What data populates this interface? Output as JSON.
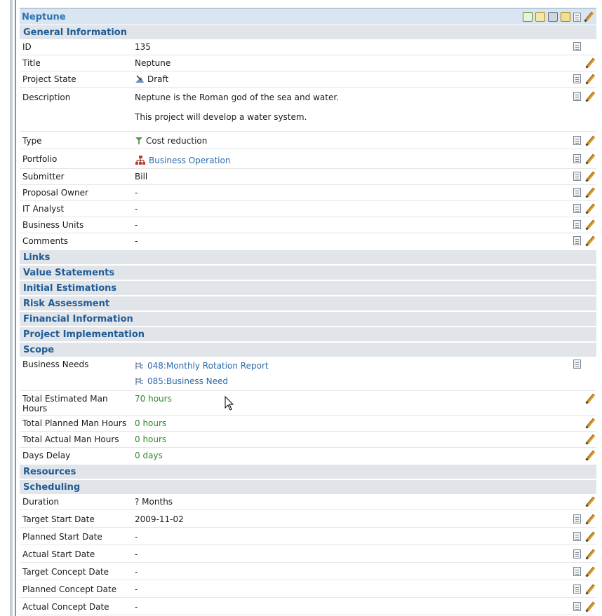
{
  "panel_title": "Neptune",
  "general": {
    "heading": "General Information",
    "rows": [
      {
        "label": "ID",
        "value": "135"
      },
      {
        "label": "Title",
        "value": "Neptune"
      },
      {
        "label": "Project State",
        "value": "Draft"
      },
      {
        "label": "Description",
        "value": "Neptune is the Roman god of the sea and water.",
        "value2": "This project will develop a water system."
      },
      {
        "label": "Type",
        "value": "Cost reduction"
      },
      {
        "label": "Portfolio",
        "value": "Business Operation"
      },
      {
        "label": "Submitter",
        "value": "Bill"
      },
      {
        "label": "Proposal Owner",
        "value": "-"
      },
      {
        "label": "IT Analyst",
        "value": "-"
      },
      {
        "label": "Business Units",
        "value": "-"
      },
      {
        "label": "Comments",
        "value": "-"
      }
    ]
  },
  "sections": {
    "links": "Links",
    "value_statements": "Value Statements",
    "initial_estimations": "Initial Estimations",
    "risk_assessment": "Risk Assessment",
    "financial_information": "Financial Information",
    "project_implementation": "Project Implementation",
    "scope": "Scope",
    "resources": "Resources",
    "scheduling": "Scheduling"
  },
  "scope": {
    "business_needs_label": "Business Needs",
    "business_needs": [
      "048:Monthly Rotation Report",
      "085:Business Need"
    ],
    "rows": [
      {
        "label": "Total Estimated Man Hours",
        "value": "70 hours"
      },
      {
        "label": "Total Planned Man Hours",
        "value": "0 hours"
      },
      {
        "label": "Total Actual Man Hours",
        "value": "0 hours"
      },
      {
        "label": "Days Delay",
        "value": "0 days"
      }
    ]
  },
  "scheduling": {
    "rows": [
      {
        "label": "Duration",
        "value": "? Months"
      },
      {
        "label": "Target Start Date",
        "value": "2009-11-02"
      },
      {
        "label": "Planned Start Date",
        "value": "-"
      },
      {
        "label": "Actual Start Date",
        "value": "-"
      },
      {
        "label": "Target Concept Date",
        "value": "-"
      },
      {
        "label": "Planned Concept Date",
        "value": "-"
      },
      {
        "label": "Actual Concept Date",
        "value": "-"
      }
    ]
  },
  "colors": {
    "accent": "#2c73b4",
    "section_bg": "#e1e4e8",
    "link": "#2b6aa8",
    "green": "#2d8a2d"
  }
}
